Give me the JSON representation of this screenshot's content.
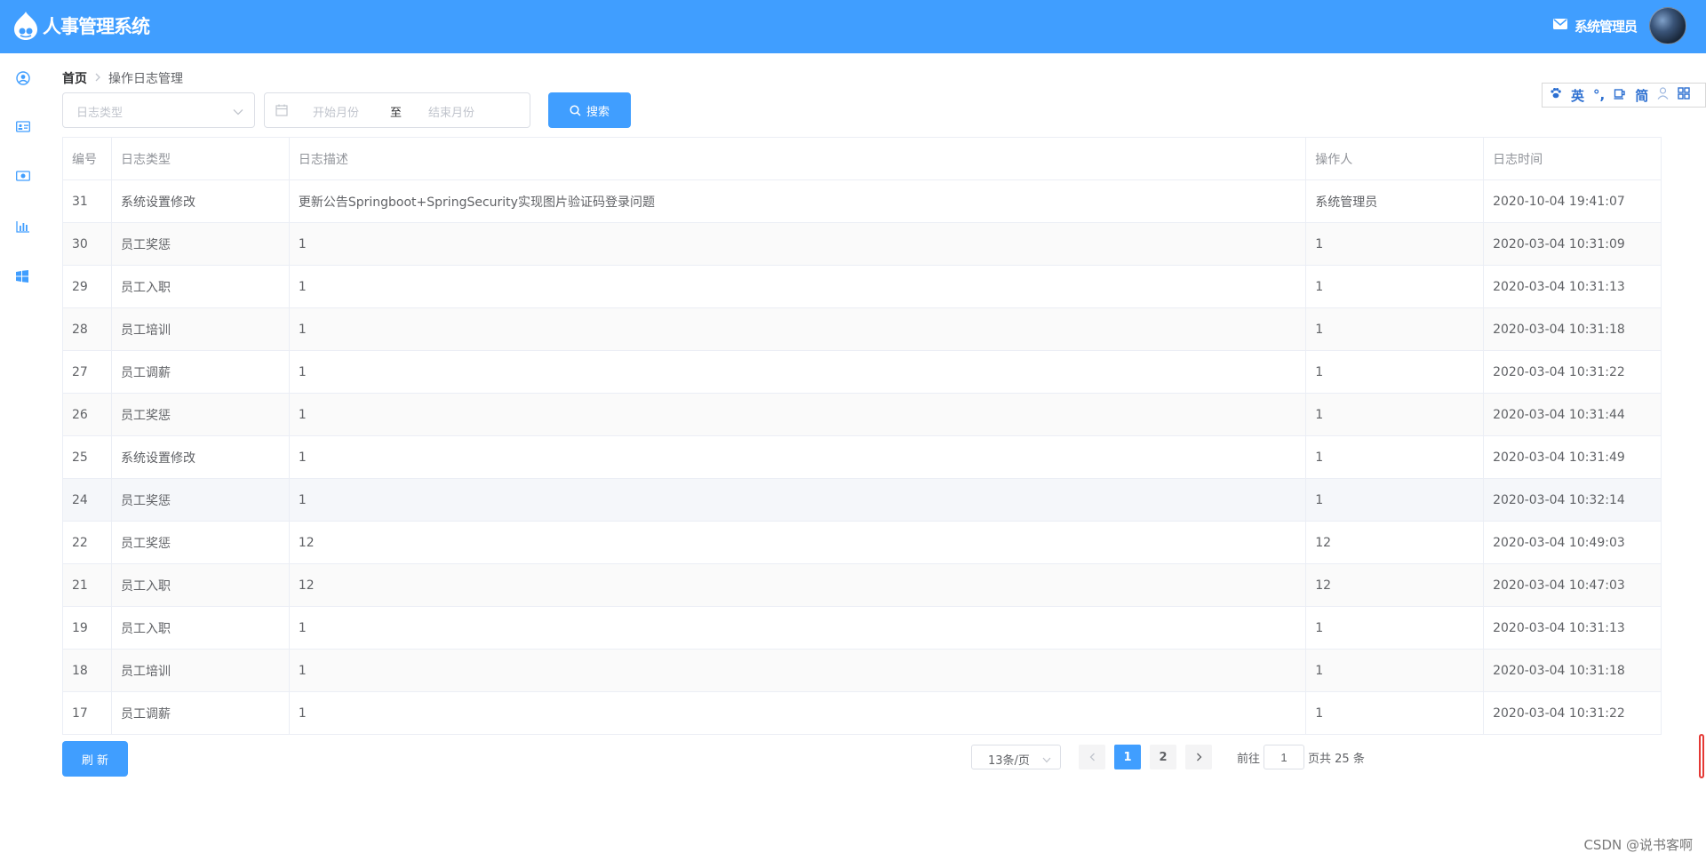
{
  "header": {
    "app_title": "人事管理系统",
    "user_name": "系统管理员",
    "brand_color": "#409eff"
  },
  "sidebar": {
    "items": [
      {
        "icon": "user-circle-icon"
      },
      {
        "icon": "id-card-icon"
      },
      {
        "icon": "money-icon"
      },
      {
        "icon": "bar-chart-icon"
      },
      {
        "icon": "windows-icon"
      }
    ]
  },
  "breadcrumb": {
    "home": "首页",
    "current": "操作日志管理"
  },
  "filters": {
    "type_placeholder": "日志类型",
    "start_placeholder": "开始月份",
    "range_separator": "至",
    "end_placeholder": "结束月份",
    "search_label": "搜索"
  },
  "ime_toolbar": {
    "lang": "英",
    "punct": "°,",
    "simp": "简"
  },
  "table": {
    "columns": [
      "编号",
      "日志类型",
      "日志描述",
      "操作人",
      "日志时间"
    ],
    "rows": [
      [
        "31",
        "系统设置修改",
        "更新公告Springboot+SpringSecurity实现图片验证码登录问题",
        "系统管理员",
        "2020-10-04 19:41:07"
      ],
      [
        "30",
        "员工奖惩",
        "1",
        "1",
        "2020-03-04 10:31:09"
      ],
      [
        "29",
        "员工入职",
        "1",
        "1",
        "2020-03-04 10:31:13"
      ],
      [
        "28",
        "员工培训",
        "1",
        "1",
        "2020-03-04 10:31:18"
      ],
      [
        "27",
        "员工调薪",
        "1",
        "1",
        "2020-03-04 10:31:22"
      ],
      [
        "26",
        "员工奖惩",
        "1",
        "1",
        "2020-03-04 10:31:44"
      ],
      [
        "25",
        "系统设置修改",
        "1",
        "1",
        "2020-03-04 10:31:49"
      ],
      [
        "24",
        "员工奖惩",
        "1",
        "1",
        "2020-03-04 10:32:14"
      ],
      [
        "22",
        "员工奖惩",
        "12",
        "12",
        "2020-03-04 10:49:03"
      ],
      [
        "21",
        "员工入职",
        "12",
        "12",
        "2020-03-04 10:47:03"
      ],
      [
        "19",
        "员工入职",
        "1",
        "1",
        "2020-03-04 10:31:13"
      ],
      [
        "18",
        "员工培训",
        "1",
        "1",
        "2020-03-04 10:31:18"
      ],
      [
        "17",
        "员工调薪",
        "1",
        "1",
        "2020-03-04 10:31:22"
      ]
    ]
  },
  "footer": {
    "refresh_label": "刷 新"
  },
  "pagination": {
    "page_size_label": "13条/页",
    "pages": [
      "1",
      "2"
    ],
    "current_page": "1",
    "goto_prefix": "前往",
    "goto_value": "1",
    "goto_suffix": "页",
    "total_text": "共 25 条"
  },
  "watermark": "CSDN @说书客啊"
}
